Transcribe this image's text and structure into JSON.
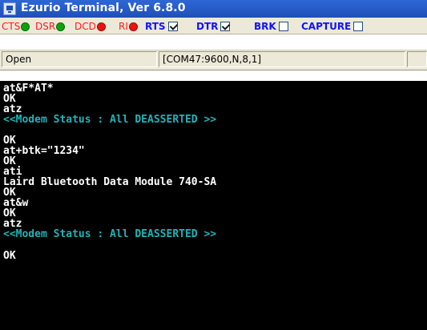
{
  "window": {
    "title": "Ezurio Terminal, Ver 6.8.0"
  },
  "signals": [
    {
      "label": "CTS",
      "color": "#0aa40a"
    },
    {
      "label": "DSR",
      "color": "#0aa40a"
    },
    {
      "label": "DCD",
      "color": "#ee1111"
    },
    {
      "label": "RI",
      "color": "#ee1111"
    }
  ],
  "controls": [
    {
      "label": "RTS",
      "checked": true
    },
    {
      "label": "DTR",
      "checked": true
    },
    {
      "label": "BRK",
      "checked": false
    },
    {
      "label": "CAPTURE",
      "checked": false
    }
  ],
  "status": {
    "port_state": "Open",
    "port_settings": "[COM47:9600,N,8,1]"
  },
  "terminal": {
    "lines": [
      {
        "text": "at&F*AT*",
        "color": "white"
      },
      {
        "text": "OK",
        "color": "white"
      },
      {
        "text": "atz",
        "color": "white"
      },
      {
        "text": "<<Modem Status : All DEASSERTED >>",
        "color": "cyan"
      },
      {
        "text": "",
        "color": "white"
      },
      {
        "text": "OK",
        "color": "white"
      },
      {
        "text": "at+btk=\"1234\"",
        "color": "white"
      },
      {
        "text": "OK",
        "color": "white"
      },
      {
        "text": "ati",
        "color": "white"
      },
      {
        "text": "Laird Bluetooth Data Module 740-SA",
        "color": "white"
      },
      {
        "text": "OK",
        "color": "white"
      },
      {
        "text": "at&w",
        "color": "white"
      },
      {
        "text": "OK",
        "color": "white"
      },
      {
        "text": "atz",
        "color": "white"
      },
      {
        "text": "<<Modem Status : All DEASSERTED >>",
        "color": "cyan"
      },
      {
        "text": "",
        "color": "white"
      },
      {
        "text": "OK",
        "color": "white"
      }
    ]
  }
}
